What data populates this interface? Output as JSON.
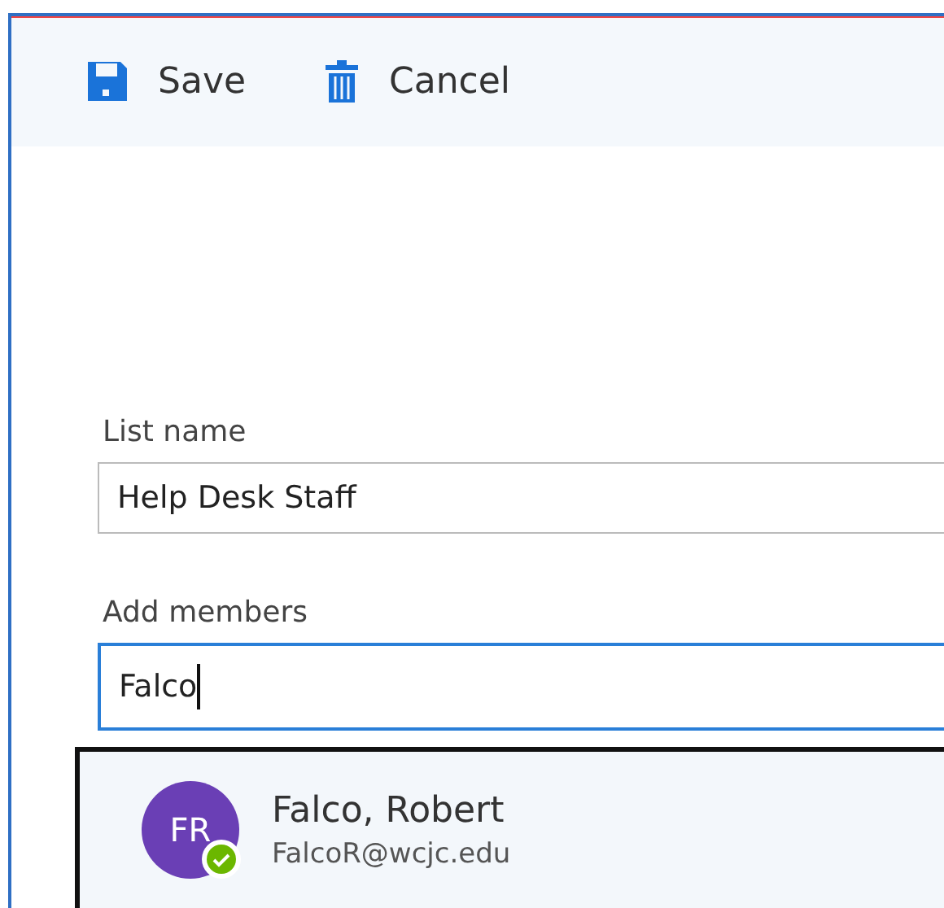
{
  "toolbar": {
    "buttons": [
      {
        "kind": "save",
        "label": "Save"
      },
      {
        "kind": "cancel",
        "label": "Cancel"
      }
    ]
  },
  "form": {
    "list_name": {
      "label": "List name",
      "value": "Help Desk Staff"
    },
    "add_members": {
      "label": "Add members",
      "value": "Falco",
      "focused": true
    }
  },
  "suggestions": [
    {
      "initials": "FR",
      "name": "Falco, Robert",
      "email": "FalcoR@wcjc.edu",
      "available": true
    }
  ]
}
